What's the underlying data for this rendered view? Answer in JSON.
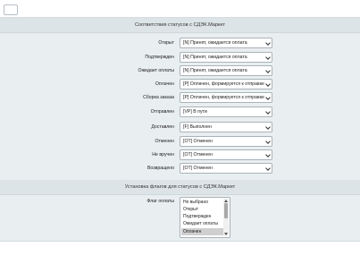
{
  "section_statuses": {
    "title": "Соответствия статусов с СДЭК.Маркет",
    "rows": [
      {
        "label": "Открыт",
        "value": "[N] Принят, ожидается оплата"
      },
      {
        "label": "Подтвержден",
        "value": "[N] Принят, ожидается оплата"
      },
      {
        "label": "Ожидает оплаты",
        "value": "[N] Принят, ожидается оплата"
      },
      {
        "label": "Оплачен",
        "value": "[P] Оплачен, формируется к отправке"
      },
      {
        "label": "Сборка заказа",
        "value": "[P] Оплачен, формируется к отправке"
      },
      {
        "label": "Отправлен",
        "value": "[VP] В пути"
      },
      {
        "label": "Доставлен",
        "value": "[F] Выполнен"
      },
      {
        "label": "Отменен",
        "value": "[OT] Отменен"
      },
      {
        "label": "Не вручен",
        "value": "[OT] Отменен"
      },
      {
        "label": "Возвращено",
        "value": "[OT] Отменен"
      }
    ]
  },
  "section_flags": {
    "title": "Установка флагов для статусов с СДЭК.Маркет",
    "payment_flag": {
      "label": "Флаг оплаты",
      "options": [
        "Не выбрано",
        "Открыт",
        "Подтвержден",
        "Ожидает оплаты",
        "Оплачен"
      ],
      "selected": "Оплачен"
    }
  }
}
